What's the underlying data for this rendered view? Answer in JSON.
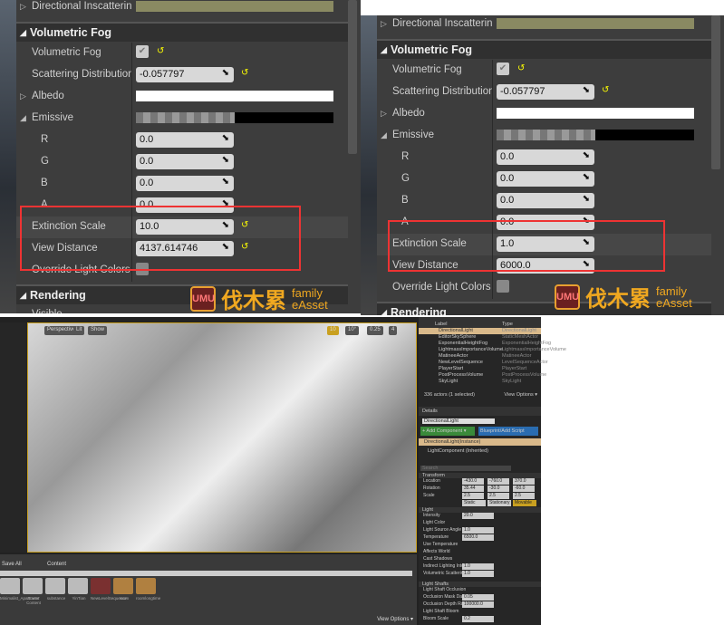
{
  "panels": [
    {
      "id": "before",
      "top_label": "Directional Inscattering",
      "section": "Volumetric Fog",
      "next_section": "Rendering",
      "next_row": "Visible",
      "rows": [
        {
          "label": "Volumetric Fog",
          "type": "check",
          "checked": true,
          "reset": true
        },
        {
          "label": "Scattering Distribution",
          "type": "num",
          "value": "-0.057797",
          "reset": true
        },
        {
          "label": "Albedo",
          "type": "color",
          "color": "#ffffff",
          "expander": "collapsed"
        },
        {
          "label": "Emissive",
          "type": "emissive",
          "expander": "expanded"
        },
        {
          "label": "R",
          "type": "num",
          "value": "0.0",
          "sub": true
        },
        {
          "label": "G",
          "type": "num",
          "value": "0.0",
          "sub": true
        },
        {
          "label": "B",
          "type": "num",
          "value": "0.0",
          "sub": true
        },
        {
          "label": "A",
          "type": "num",
          "value": "0.0",
          "sub": true
        },
        {
          "label": "Extinction Scale",
          "type": "num",
          "value": "10.0",
          "reset": true
        },
        {
          "label": "View Distance",
          "type": "num",
          "value": "4137.614746",
          "reset": true
        },
        {
          "label": "Override Light Colors",
          "type": "check",
          "checked": false
        }
      ]
    },
    {
      "id": "after",
      "top_label": "Directional Inscattering",
      "section": "Volumetric Fog",
      "next_section": "Rendering",
      "rows": [
        {
          "label": "Volumetric Fog",
          "type": "check",
          "checked": true,
          "reset": true
        },
        {
          "label": "Scattering Distribution",
          "type": "num",
          "value": "-0.057797",
          "reset": true
        },
        {
          "label": "Albedo",
          "type": "color",
          "color": "#ffffff",
          "expander": "collapsed"
        },
        {
          "label": "Emissive",
          "type": "emissive",
          "expander": "expanded"
        },
        {
          "label": "R",
          "type": "num",
          "value": "0.0",
          "sub": true
        },
        {
          "label": "G",
          "type": "num",
          "value": "0.0",
          "sub": true
        },
        {
          "label": "B",
          "type": "num",
          "value": "0.0",
          "sub": true
        },
        {
          "label": "A",
          "type": "num",
          "value": "0.0",
          "sub": true
        },
        {
          "label": "Extinction Scale",
          "type": "num",
          "value": "1.0"
        },
        {
          "label": "View Distance",
          "type": "num",
          "value": "6000.0"
        },
        {
          "label": "Override Light Colors",
          "type": "check",
          "checked": false
        }
      ]
    }
  ],
  "watermark": {
    "badge": "UMU",
    "chinese": "伐木累",
    "english1": "family",
    "english2": "eAsset"
  },
  "colors": {
    "inscattering": "#8a8a62",
    "highlight": "#e33333",
    "accent": "#c9a020"
  },
  "editor": {
    "viewport": {
      "perspective": "Perspective",
      "lit": "Lit",
      "show": "Show",
      "grid": "10",
      "angle": "10°",
      "scale": "0.25",
      "cams": "4"
    },
    "content": {
      "save_all": "Save All",
      "path": "Content",
      "view_options": "View Options ▾",
      "assets": [
        "Minimalist_Apartment",
        "Starter Content",
        "substance",
        "YinTian",
        "NewLevelSequence",
        "room",
        "roomlongtime"
      ]
    },
    "outliner": {
      "col_label": "Label",
      "col_type": "Type",
      "items": [
        [
          "DirectionalLight",
          "DirectionalLight"
        ],
        [
          "EditorSkySphere",
          "StaticMeshActor"
        ],
        [
          "ExponentialHeightFog",
          "ExponentialHeightFog"
        ],
        [
          "LightmassImportanceVolume",
          "LightmassImportanceVolume"
        ],
        [
          "MatineeActor",
          "MatineeActor"
        ],
        [
          "NewLevelSequence",
          "LevelSequenceActor"
        ],
        [
          "PlayerStart",
          "PlayerStart"
        ],
        [
          "PostProcessVolume",
          "PostProcessVolume"
        ],
        [
          "SkyLight",
          "SkyLight"
        ]
      ],
      "count": "336 actors (1 selected)",
      "view_options": "View Options ▾"
    },
    "details": {
      "tab": "Details",
      "name": "DirectionalLight",
      "add_component": "+ Add Component ▾",
      "blueprint": "Blueprint/Add Script",
      "instance": "DirectionalLight(Instance)",
      "component": "LightComponent (Inherited)",
      "search": "Search",
      "transform": "Transform",
      "location": [
        "-430.0",
        "-760.0",
        "370.0"
      ],
      "rotation": [
        "35.44",
        "-30.0",
        "-60.0"
      ],
      "scale": [
        "2.5",
        "2.5",
        "2.5"
      ],
      "mobility": [
        "Static",
        "Stationary",
        "Movable"
      ],
      "light": "Light",
      "rows": [
        [
          "Intensity",
          "20.0"
        ],
        [
          "Light Color",
          ""
        ],
        [
          "Light Source Angle",
          "1.0"
        ],
        [
          "Temperature",
          "6500.0"
        ],
        [
          "Use Temperature",
          ""
        ],
        [
          "Affects World",
          ""
        ],
        [
          "Cast Shadows",
          ""
        ],
        [
          "Indirect Lighting Intensity",
          "1.0"
        ],
        [
          "Volumetric Scattering",
          "1.0"
        ]
      ],
      "shafts": "Light Shafts",
      "shaft_rows": [
        [
          "Light Shaft Occlusion",
          ""
        ],
        [
          "Occlusion Mask Darkness",
          "0.05"
        ],
        [
          "Occlusion Depth Range",
          "100000.0"
        ],
        [
          "Light Shaft Bloom",
          ""
        ],
        [
          "Bloom Scale",
          "0.2"
        ]
      ]
    }
  }
}
